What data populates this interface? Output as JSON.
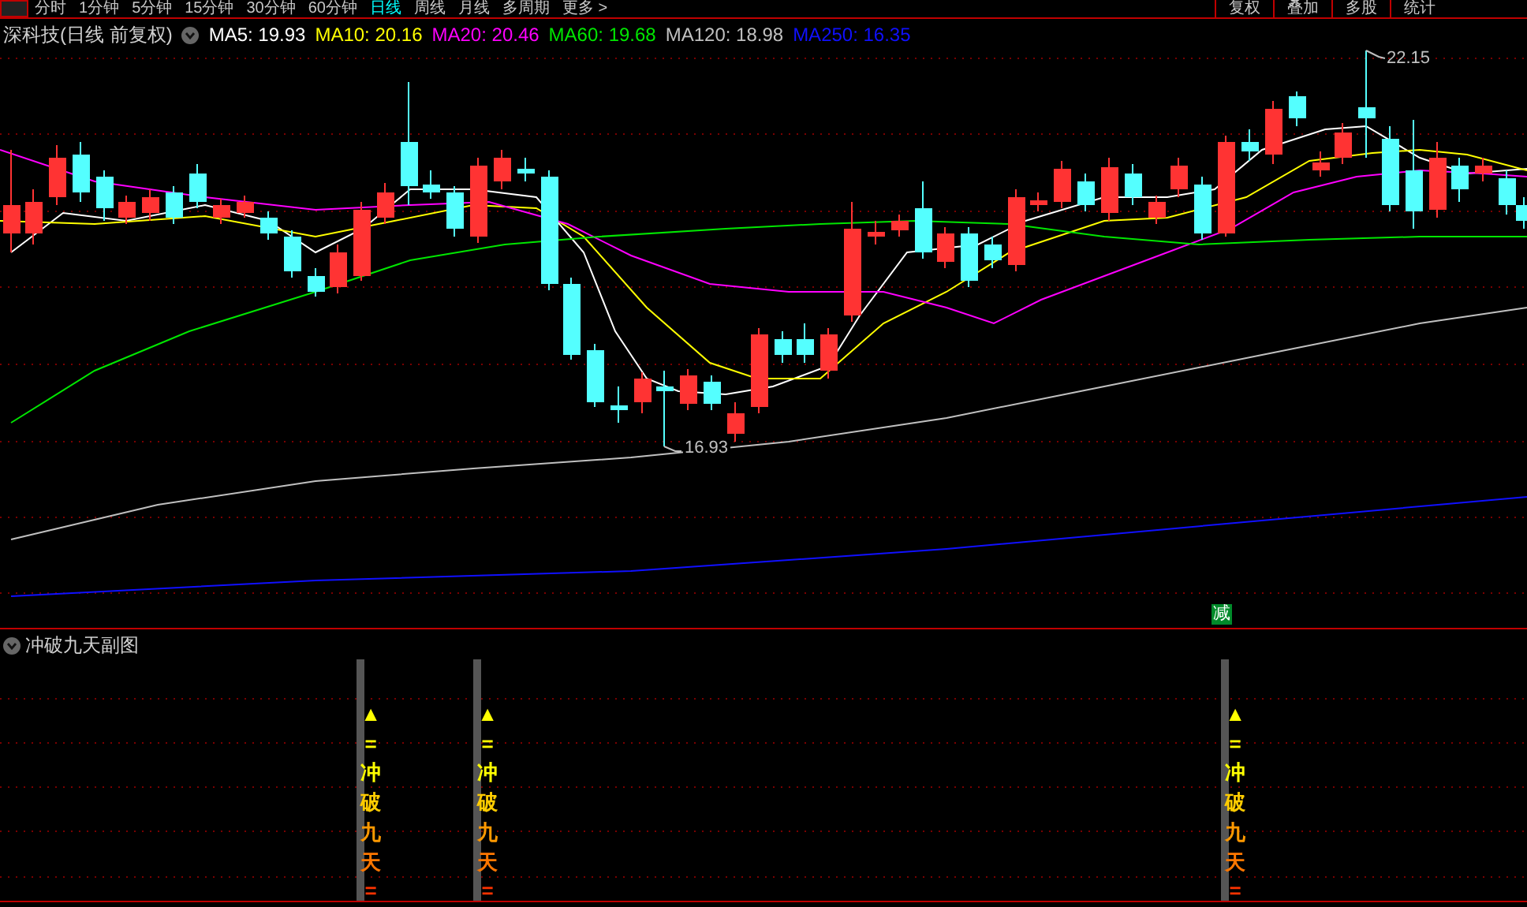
{
  "period_tabs": [
    {
      "label": "分时",
      "selected": false
    },
    {
      "label": "1分钟",
      "selected": false
    },
    {
      "label": "5分钟",
      "selected": false
    },
    {
      "label": "15分钟",
      "selected": false
    },
    {
      "label": "30分钟",
      "selected": false
    },
    {
      "label": "60分钟",
      "selected": false
    },
    {
      "label": "日线",
      "selected": true
    },
    {
      "label": "周线",
      "selected": false
    },
    {
      "label": "月线",
      "selected": false
    },
    {
      "label": "多周期",
      "selected": false
    },
    {
      "label": "更多 >",
      "selected": false
    }
  ],
  "toolbar_buttons": [
    "复权",
    "叠加",
    "多股",
    "统计"
  ],
  "main_chart": {
    "title": "深科技(日线 前复权)",
    "ma_legend": [
      {
        "label": "MA5: 19.93",
        "color": "#ffffff"
      },
      {
        "label": "MA10: 20.16",
        "color": "#ffff00"
      },
      {
        "label": "MA20: 20.46",
        "color": "#ff00ff"
      },
      {
        "label": "MA60: 19.68",
        "color": "#00e600"
      },
      {
        "label": "MA120: 18.98",
        "color": "#c0c0c0"
      },
      {
        "label": "MA250: 16.35",
        "color": "#1010ff"
      }
    ],
    "high_label": "22.15",
    "low_label": "16.93",
    "signal_badge": "减"
  },
  "sub_chart": {
    "title": "冲破九天副图",
    "signals": [
      {
        "glyphs": [
          {
            "text": "▲",
            "color": "#ffff00"
          },
          {
            "text": "=",
            "color": "#ffff00"
          },
          {
            "text": "冲",
            "color": "#ffff00"
          },
          {
            "text": "破",
            "color": "#ffcc00"
          },
          {
            "text": "九",
            "color": "#ff9900"
          },
          {
            "text": "天",
            "color": "#ff7700"
          },
          {
            "text": "=",
            "color": "#ff3300"
          }
        ]
      },
      {
        "glyphs": [
          {
            "text": "▲",
            "color": "#ffff00"
          },
          {
            "text": "=",
            "color": "#ffff00"
          },
          {
            "text": "冲",
            "color": "#ffff00"
          },
          {
            "text": "破",
            "color": "#ffcc00"
          },
          {
            "text": "九",
            "color": "#ff9900"
          },
          {
            "text": "天",
            "color": "#ff7700"
          },
          {
            "text": "=",
            "color": "#ff3300"
          }
        ]
      },
      {
        "glyphs": [
          {
            "text": "▲",
            "color": "#ffff00"
          },
          {
            "text": "=",
            "color": "#ffff00"
          },
          {
            "text": "冲",
            "color": "#ffff00"
          },
          {
            "text": "破",
            "color": "#ffcc00"
          },
          {
            "text": "九",
            "color": "#ff9900"
          },
          {
            "text": "天",
            "color": "#ff7700"
          },
          {
            "text": "=",
            "color": "#ff3300"
          }
        ]
      }
    ]
  }
}
